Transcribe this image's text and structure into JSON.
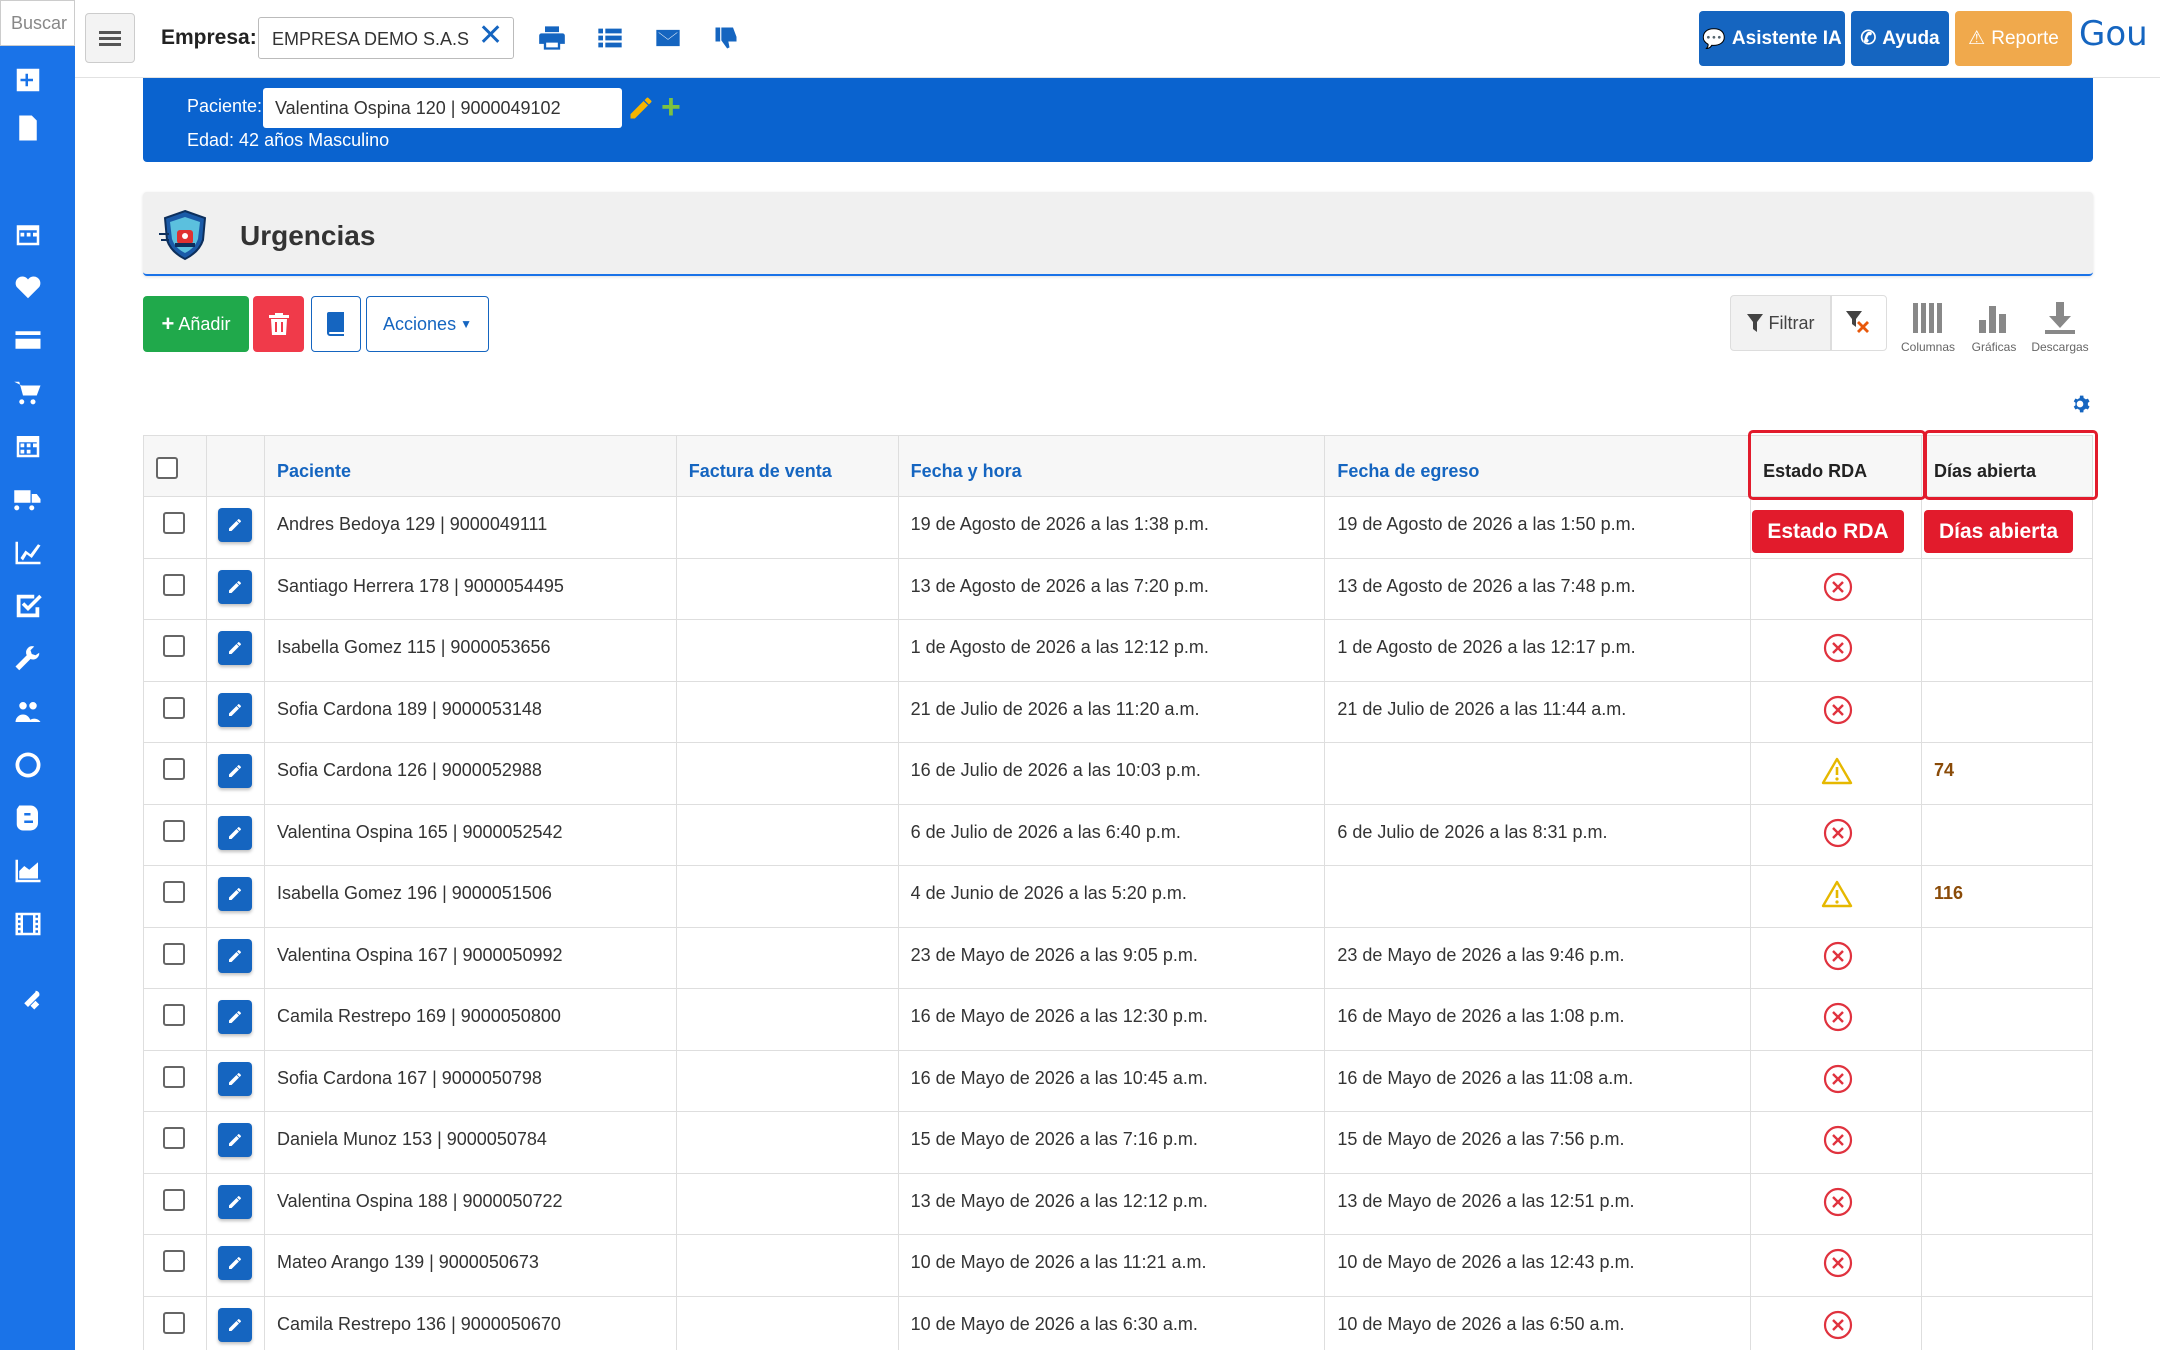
{
  "sidebar": {
    "search_placeholder": "Buscar",
    "icons": [
      "plus-square-icon",
      "rips-doc-icon",
      "calendar-icon",
      "heart-icon",
      "credit-card-icon",
      "cart-icon",
      "calendar-grid-icon",
      "truck-icon",
      "line-chart-icon",
      "checklist-icon",
      "wrench-icon",
      "users-icon",
      "circle-icon",
      "blogger-icon",
      "area-chart-icon",
      "film-icon",
      "tools-icon"
    ]
  },
  "topbar": {
    "empresa_label": "Empresa:",
    "empresa_value": "EMPRESA DEMO S.A.S",
    "asistente_label": "Asistente IA",
    "ayuda_label": "Ayuda",
    "reporte_label": "Reporte",
    "brand": "Gou"
  },
  "patient": {
    "label": "Paciente:",
    "value": "Valentina Ospina 120 | 9000049102",
    "age": "Edad: 42 años Masculino"
  },
  "module": {
    "title": "Urgencias"
  },
  "actions": {
    "add_label": "Añadir",
    "acciones_label": "Acciones",
    "filter_label": "Filtrar",
    "columns_label": "Columnas",
    "charts_label": "Gráficas",
    "downloads_label": "Descargas"
  },
  "table": {
    "headers": {
      "paciente": "Paciente",
      "factura": "Factura de venta",
      "fecha": "Fecha y hora",
      "egreso": "Fecha de egreso",
      "estado": "Estado RDA",
      "dias": "Días abierta"
    },
    "annotations": {
      "estado": "Estado RDA",
      "dias": "Días abierta"
    },
    "rows": [
      {
        "paciente": "Andres Bedoya 129 | 9000049111",
        "factura": "",
        "fecha": "19 de Agosto de 2026 a las 1:38 p.m.",
        "egreso": "19 de Agosto de 2026 a las 1:50 p.m.",
        "estado": "none",
        "dias": ""
      },
      {
        "paciente": "Santiago Herrera 178 | 9000054495",
        "factura": "",
        "fecha": "13 de Agosto de 2026 a las 7:20 p.m.",
        "egreso": "13 de Agosto de 2026 a las 7:48 p.m.",
        "estado": "error",
        "dias": ""
      },
      {
        "paciente": "Isabella Gomez 115 | 9000053656",
        "factura": "",
        "fecha": "1 de Agosto de 2026 a las 12:12 p.m.",
        "egreso": "1 de Agosto de 2026 a las 12:17 p.m.",
        "estado": "error",
        "dias": ""
      },
      {
        "paciente": "Sofia Cardona 189 | 9000053148",
        "factura": "",
        "fecha": "21 de Julio de 2026 a las 11:20 a.m.",
        "egreso": "21 de Julio de 2026 a las 11:44 a.m.",
        "estado": "error",
        "dias": ""
      },
      {
        "paciente": "Sofia Cardona 126 | 9000052988",
        "factura": "",
        "fecha": "16 de Julio de 2026 a las 10:03 p.m.",
        "egreso": "",
        "estado": "warning",
        "dias": "74"
      },
      {
        "paciente": "Valentina Ospina 165 | 9000052542",
        "factura": "",
        "fecha": "6 de Julio de 2026 a las 6:40 p.m.",
        "egreso": "6 de Julio de 2026 a las 8:31 p.m.",
        "estado": "error",
        "dias": ""
      },
      {
        "paciente": "Isabella Gomez 196 | 9000051506",
        "factura": "",
        "fecha": "4 de Junio de 2026 a las 5:20 p.m.",
        "egreso": "",
        "estado": "warning",
        "dias": "116"
      },
      {
        "paciente": "Valentina Ospina 167 | 9000050992",
        "factura": "",
        "fecha": "23 de Mayo de 2026 a las 9:05 p.m.",
        "egreso": "23 de Mayo de 2026 a las 9:46 p.m.",
        "estado": "error",
        "dias": ""
      },
      {
        "paciente": "Camila Restrepo 169 | 9000050800",
        "factura": "",
        "fecha": "16 de Mayo de 2026 a las 12:30 p.m.",
        "egreso": "16 de Mayo de 2026 a las 1:08 p.m.",
        "estado": "error",
        "dias": ""
      },
      {
        "paciente": "Sofia Cardona 167 | 9000050798",
        "factura": "",
        "fecha": "16 de Mayo de 2026 a las 10:45 a.m.",
        "egreso": "16 de Mayo de 2026 a las 11:08 a.m.",
        "estado": "error",
        "dias": ""
      },
      {
        "paciente": "Daniela Munoz 153 | 9000050784",
        "factura": "",
        "fecha": "15 de Mayo de 2026 a las 7:16 p.m.",
        "egreso": "15 de Mayo de 2026 a las 7:56 p.m.",
        "estado": "error",
        "dias": ""
      },
      {
        "paciente": "Valentina Ospina 188 | 9000050722",
        "factura": "",
        "fecha": "13 de Mayo de 2026 a las 12:12 p.m.",
        "egreso": "13 de Mayo de 2026 a las 12:51 p.m.",
        "estado": "error",
        "dias": ""
      },
      {
        "paciente": "Mateo Arango 139 | 9000050673",
        "factura": "",
        "fecha": "10 de Mayo de 2026 a las 11:21 a.m.",
        "egreso": "10 de Mayo de 2026 a las 12:43 p.m.",
        "estado": "error",
        "dias": ""
      },
      {
        "paciente": "Camila Restrepo 136 | 9000050670",
        "factura": "",
        "fecha": "10 de Mayo de 2026 a las 6:30 a.m.",
        "egreso": "10 de Mayo de 2026 a las 6:50 a.m.",
        "estado": "error",
        "dias": ""
      }
    ]
  },
  "colors": {
    "primary": "#1565c0",
    "sidebar": "#1a73e8",
    "band": "#0a63cf",
    "add": "#20a94b",
    "delete": "#f03a4a",
    "report": "#f0a94c",
    "error": "#e0323e",
    "warning": "#e6b800",
    "highlight": "#e21b2c"
  }
}
